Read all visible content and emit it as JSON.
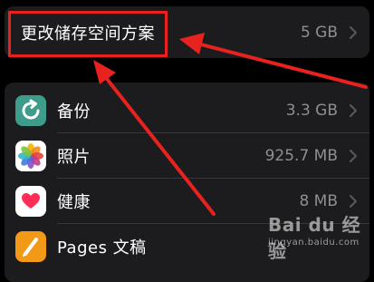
{
  "plan_row": {
    "label": "更改储存空间方案",
    "value": "5 GB"
  },
  "apps": [
    {
      "name": "备份",
      "value": "3.3 GB",
      "icon": "backup-icon"
    },
    {
      "name": "照片",
      "value": "925.7 MB",
      "icon": "photos-icon"
    },
    {
      "name": "健康",
      "value": "8 MB",
      "icon": "health-icon"
    },
    {
      "name": "Pages 文稿",
      "value": "",
      "icon": "pages-icon"
    }
  ],
  "annotation": {
    "highlight_color": "#e8221f"
  },
  "watermark": {
    "brand": "Bai du 经验",
    "url": "jingyan.baidu.com"
  }
}
